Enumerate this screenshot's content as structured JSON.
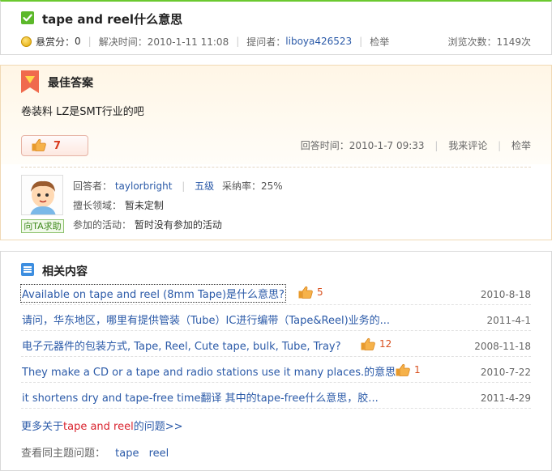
{
  "question": {
    "title": "tape and reel什么意思",
    "reward_label": "悬赏分：",
    "reward_value": "0",
    "solved_time": "解决时间：2010-1-11 11:08",
    "asker_label": "提问者：",
    "asker": "liboya426523",
    "report": "检举",
    "views": "浏览次数：1149次"
  },
  "best_answer": {
    "heading": "最佳答案",
    "text": "卷装料  LZ是SMT行业的吧",
    "likes": "7",
    "answer_time": "回答时间：2010-1-7 09:33",
    "comment": "我来评论",
    "report": "检举",
    "answerer_label": "回答者：",
    "answerer": "taylorbright",
    "level": "五级",
    "adopt_rate": "采纳率：25%",
    "expertise_label": "擅长领域：",
    "expertise": "暂未定制",
    "activity_label": "参加的活动：",
    "activity": "暂时没有参加的活动",
    "help_button": "向TA求助"
  },
  "related": {
    "heading": "相关内容",
    "items": [
      {
        "title": "Available on tape and reel (8mm Tape)是什么意思?",
        "likes": "5",
        "date": "2010-8-18"
      },
      {
        "title": "请问，华东地区，哪里有提供管装（Tube）IC进行编带（Tape&Reel)业务的...",
        "likes": "",
        "date": "2011-4-1"
      },
      {
        "title": "电子元器件的包装方式, Tape, Reel, Cute tape, bulk, Tube, Tray?",
        "likes": "12",
        "date": "2008-11-18"
      },
      {
        "title": "They make a CD or a tape and radio stations use it many places.的意思",
        "likes": "1",
        "date": "2010-7-22"
      },
      {
        "title": "it shortens dry and tape-free time翻译 其中的tape-free什么意思，胶...",
        "likes": "",
        "date": "2011-4-29"
      }
    ],
    "more_prefix": "更多关于",
    "more_keyword": "tape and reel",
    "more_suffix": "的问题>>",
    "topics_label": "查看同主题问题：",
    "topics": [
      "tape",
      "reel"
    ]
  },
  "colors": {
    "accent_green": "#6bc92f",
    "link_blue": "#2b5aa8",
    "like_red": "#d93a1e",
    "keyword_red": "#d9232e"
  },
  "icons": [
    "check-icon",
    "coin-icon",
    "best-answer-ribbon-icon",
    "thumbs-up-icon",
    "avatar",
    "related-list-icon"
  ]
}
